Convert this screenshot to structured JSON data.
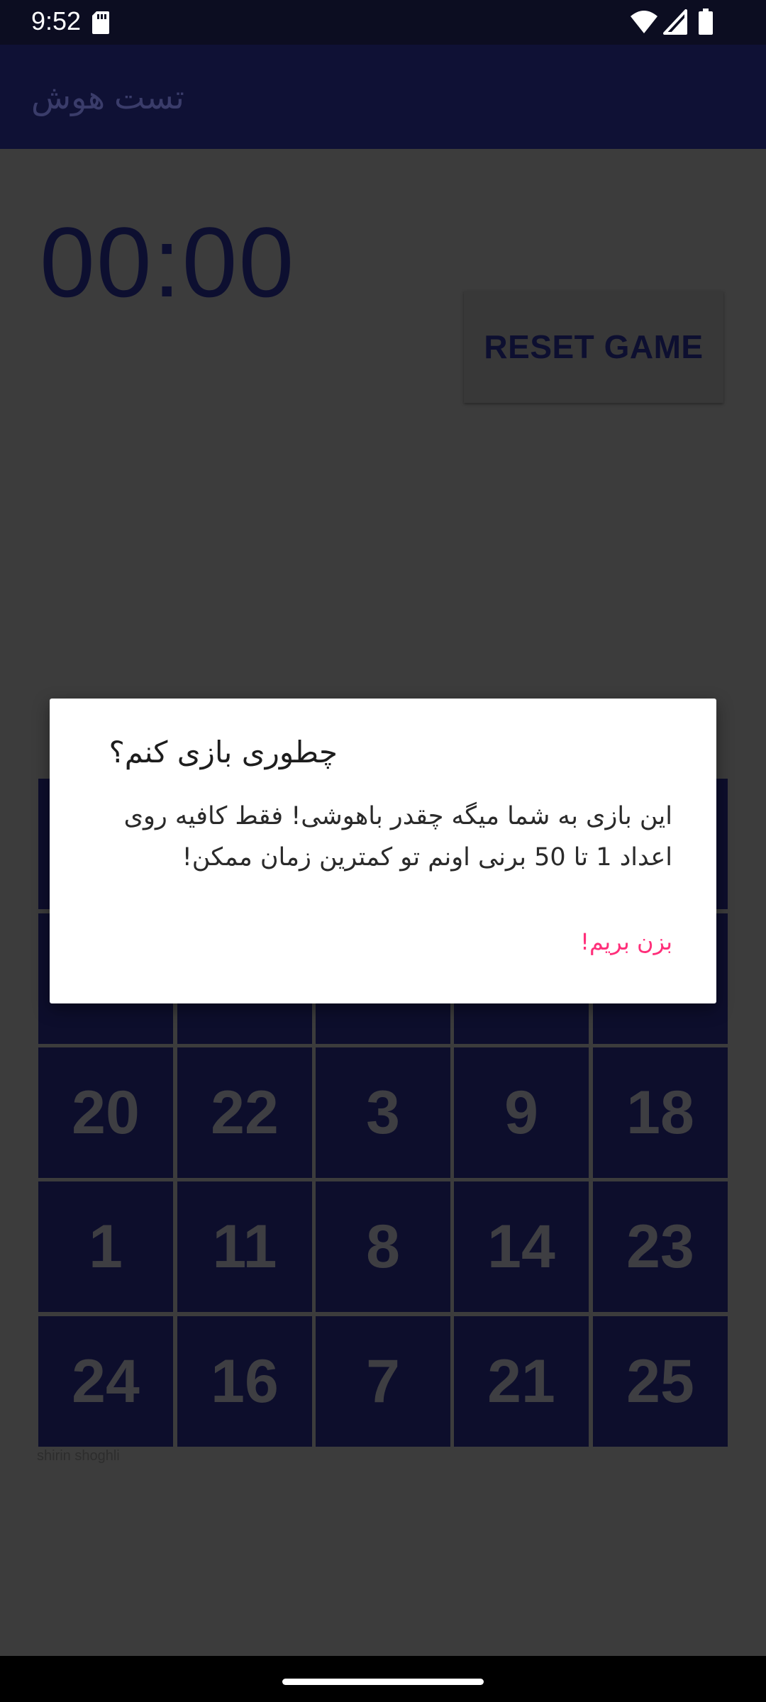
{
  "status_bar": {
    "time": "9:52",
    "icons": [
      "sd-card-icon",
      "wifi-icon",
      "cell-signal-icon",
      "battery-icon"
    ]
  },
  "app_bar": {
    "title": "تست هوش"
  },
  "game": {
    "timer": "00:00",
    "reset_label": "RESET GAME",
    "rows": [
      [
        "",
        "",
        "",
        "",
        ""
      ],
      [
        "",
        "",
        "",
        "",
        ""
      ],
      [
        "20",
        "22",
        "3",
        "9",
        "18"
      ],
      [
        "1",
        "11",
        "8",
        "14",
        "23"
      ],
      [
        "24",
        "16",
        "7",
        "21",
        "25"
      ]
    ],
    "credit": "shirin shoghli"
  },
  "dialog": {
    "title": "چطوری بازی کنم؟",
    "message": "این بازی به شما میگه چقدر باهوشی! فقط کافیه روی اعداد 1 تا 50 برنی اونم تو کمترین زمان ممکن!",
    "button_label": "بزن بریم!"
  },
  "colors": {
    "status_bar": "#0c0d21",
    "app_bar": "#0f1135",
    "background": "#3c3c3c",
    "tile": "#0d0e2c",
    "accent": "#ff2f7a"
  }
}
